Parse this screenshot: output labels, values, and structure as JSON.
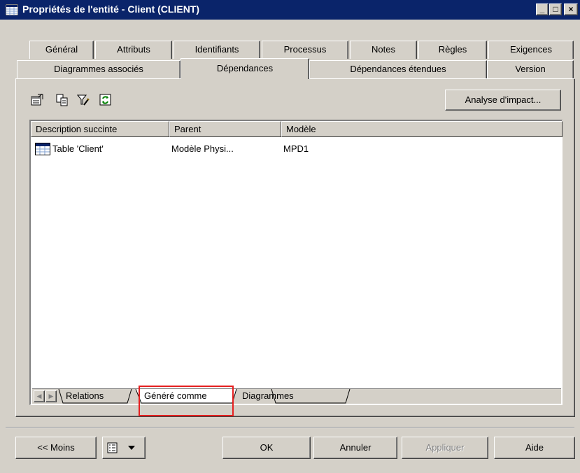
{
  "window": {
    "title": "Propriétés de l'entité - Client (CLIENT)",
    "controls": [
      "_",
      "□",
      "×"
    ]
  },
  "tabs": {
    "row1": [
      "Général",
      "Attributs",
      "Identifiants",
      "Processus",
      "Notes",
      "Règles",
      "Exigences"
    ],
    "row2": [
      "Diagrammes associés",
      "Dépendances",
      "Dépendances étendues",
      "Version"
    ],
    "active": "Dépendances"
  },
  "toolbar": {
    "icons": [
      "properties-icon",
      "copy-icon",
      "filter-icon",
      "refresh-icon"
    ],
    "impact_button": "Analyse d'impact..."
  },
  "list": {
    "columns": [
      "Description succinte",
      "Parent",
      "Modèle"
    ],
    "rows": [
      {
        "description": "Table 'Client'",
        "parent": "Modèle Physi...",
        "model": "MPD1"
      }
    ]
  },
  "subtabs": {
    "items": [
      "Relations",
      "Généré comme",
      "Diagrammes"
    ],
    "active": "Généré comme",
    "highlight_color": "#e52020"
  },
  "footer": {
    "less": "<< Moins",
    "ok": "OK",
    "cancel": "Annuler",
    "apply": "Appliquer",
    "help": "Aide"
  },
  "colors": {
    "titlebar": "#0a246a",
    "face": "#d4d0c8"
  }
}
